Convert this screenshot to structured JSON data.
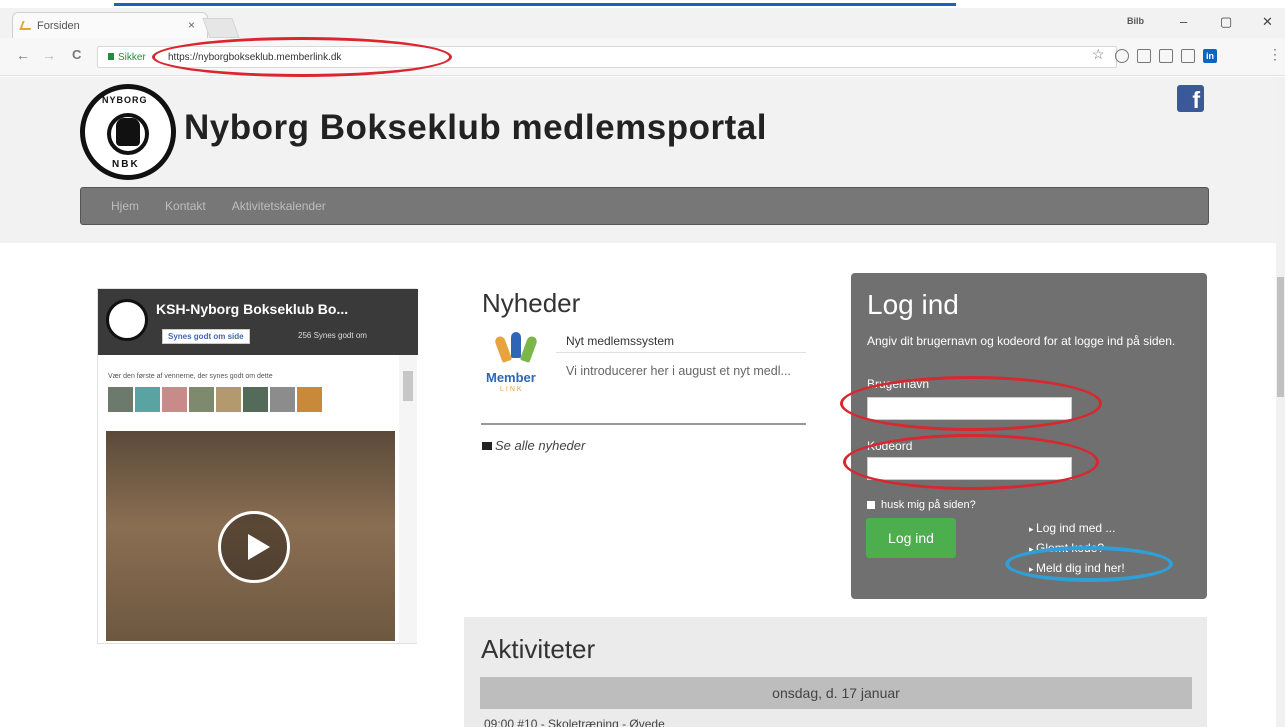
{
  "browser": {
    "tab_title": "Forsiden",
    "tab_close": "×",
    "user_badge": "Bilb",
    "window_controls": {
      "minimize": "–",
      "maximize": "▢",
      "close": "✕"
    },
    "secure_label": "Sikker",
    "url": "https://nyborgbokseklub.memberlink.dk",
    "nav": {
      "back": "←",
      "forward": "→",
      "reload": "C"
    },
    "star": "☆",
    "menu": "⋮",
    "extensions": [
      "shield-icon",
      "square-extension-icon",
      "square-extension-icon",
      "cast-icon",
      "linkedin-icon"
    ],
    "linkedin_label": "in"
  },
  "site": {
    "title": "Nyborg Bokseklub medlemsportal",
    "logo_top": "NYBORG",
    "logo_bottom": "NBK",
    "facebook_glyph": "f",
    "nav": [
      "Hjem",
      "Kontakt",
      "Aktivitetskalender"
    ]
  },
  "facebook_widget": {
    "page_name": "KSH-Nyborg Bokseklub Bo...",
    "like_button": "Synes godt om side",
    "likes": "256 Synes godt om",
    "friends_text": "Vær den første af vennerne, der synes godt om dette"
  },
  "news": {
    "title": "Nyheder",
    "logo_text": "Member",
    "logo_sub": "LINK",
    "item_title": "Nyt medlemssystem",
    "item_text": "Vi introducerer her i august et nyt medl...",
    "see_all": "Se alle nyheder"
  },
  "login": {
    "title": "Log ind",
    "description": "Angiv dit brugernavn og kodeord for at logge ind på siden.",
    "username_label": "Brugernavn",
    "username_value": "",
    "password_label": "Kodeord",
    "password_value": "",
    "remember_label": "husk mig på siden?",
    "button": "Log ind",
    "links": [
      "Log ind med ...",
      "Glemt kode?",
      "Meld dig ind her!"
    ]
  },
  "activities": {
    "title": "Aktiviteter",
    "day_header": "onsdag, d. 17 januar",
    "first_row": "09:00   #10 - Skoletræning - Øvede"
  },
  "colors": {
    "accent_green": "#4cae4c",
    "panel_gray": "#707070",
    "annotation_red": "#d9262f",
    "annotation_blue": "#2f9fd8",
    "facebook_blue": "#3b5998"
  }
}
